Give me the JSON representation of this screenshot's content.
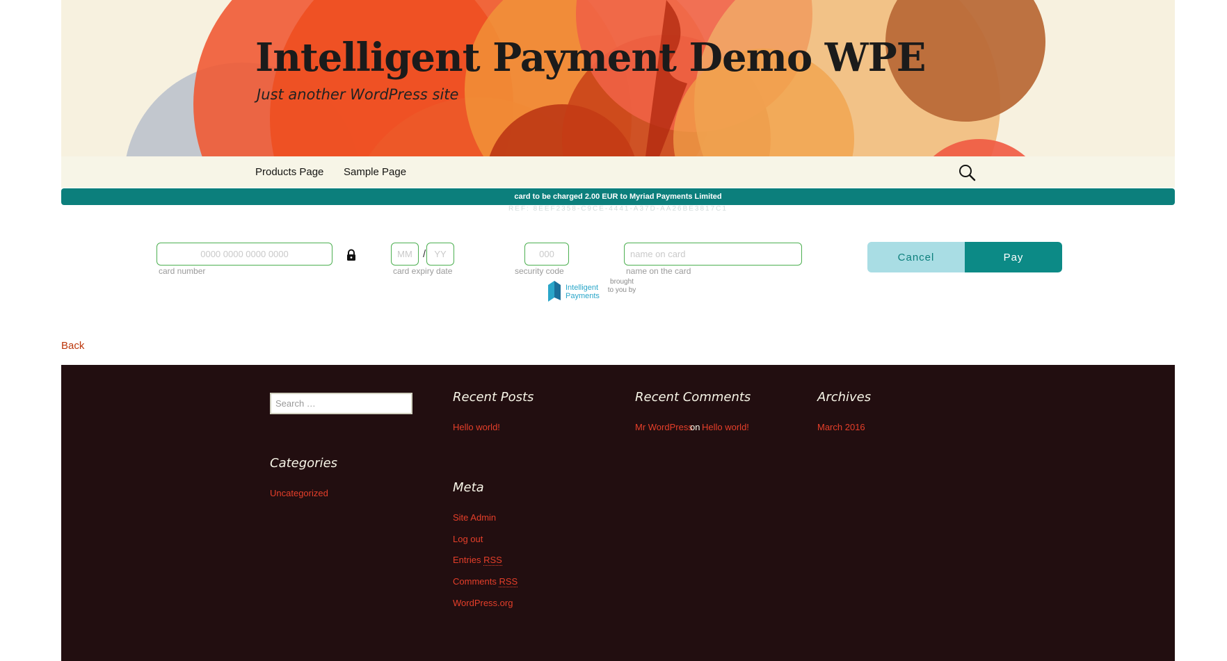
{
  "site": {
    "title": "Intelligent Payment Demo WPE",
    "description": "Just another WordPress site"
  },
  "nav": {
    "items": [
      {
        "label": "Products Page"
      },
      {
        "label": "Sample Page"
      }
    ],
    "search_icon": "search-icon"
  },
  "payment": {
    "charge_text": "card to be charged 2.00 EUR to Myriad Payments Limited",
    "reference": "REF: 8EEF2358-C9CE-4441-A37D-AA26BE3817C1",
    "card_number": {
      "placeholder": "0000 0000 0000 0000",
      "label": "card number"
    },
    "lock_icon": "lock-icon",
    "expiry": {
      "month_placeholder": "MM",
      "year_placeholder": "YY",
      "separator": "/",
      "label": "card expiry date"
    },
    "security_code": {
      "placeholder": "000",
      "label": "security code"
    },
    "name_on_card": {
      "placeholder": "name on card",
      "label": "name on the card"
    },
    "cancel_label": "Cancel",
    "pay_label": "Pay",
    "brand": {
      "name": "Intelligent\nPayments",
      "tagline": "brought\nto you by"
    }
  },
  "back_link": "Back",
  "footer": {
    "search_placeholder": "Search …",
    "categories": {
      "title": "Categories",
      "items": [
        "Uncategorized"
      ]
    },
    "recent_posts": {
      "title": "Recent Posts",
      "items": [
        "Hello world!"
      ]
    },
    "meta": {
      "title": "Meta",
      "items": [
        "Site Admin",
        "Log out",
        "Entries",
        "Comments",
        "WordPress.org"
      ],
      "rss": "RSS"
    },
    "recent_comments": {
      "title": "Recent Comments",
      "author": "Mr WordPress",
      "on": "on",
      "post": "Hello world!"
    },
    "archives": {
      "title": "Archives",
      "items": [
        "March 2016"
      ]
    }
  },
  "colors": {
    "accent_teal": "#0c7f7c",
    "link_red": "#bc360a",
    "footer_bg": "#220e10",
    "header_bg": "#f7f1df"
  }
}
